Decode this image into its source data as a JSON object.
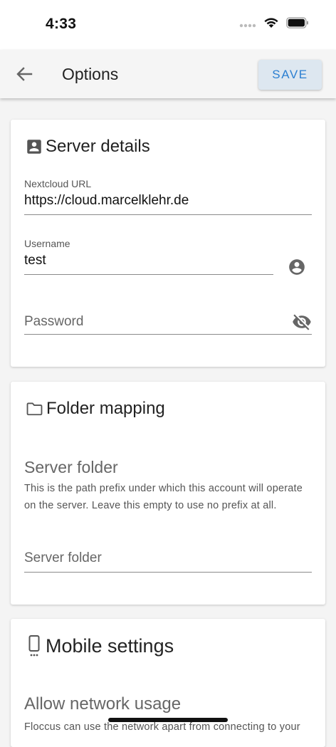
{
  "status_bar": {
    "time": "4:33"
  },
  "app_bar": {
    "title": "Options",
    "save_label": "SAVE"
  },
  "server_details": {
    "title": "Server details",
    "url_label": "Nextcloud URL",
    "url_value": "https://cloud.marcelklehr.de",
    "username_label": "Username",
    "username_value": "test",
    "password_placeholder": "Password"
  },
  "folder_mapping": {
    "title": "Folder mapping",
    "server_folder_heading": "Server folder",
    "server_folder_help": "This is the path prefix under which this account will operate on the server. Leave this empty to use no prefix at all.",
    "server_folder_placeholder": "Server folder"
  },
  "mobile_settings": {
    "title": "Mobile settings",
    "network_heading": "Allow network usage",
    "network_help": "Floccus can use the network apart from connecting to your"
  }
}
